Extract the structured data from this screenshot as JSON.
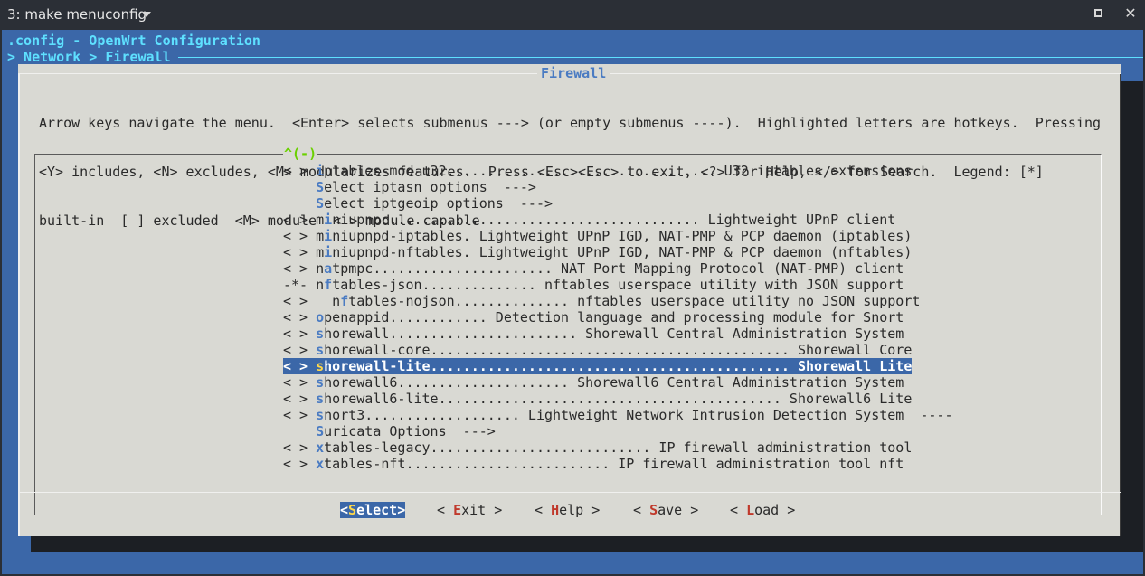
{
  "window": {
    "title": "3: make menuconfig"
  },
  "header": {
    "config_line": ".config - OpenWrt Configuration",
    "breadcrumb": "> Network > Firewall"
  },
  "dialog": {
    "title": "Firewall",
    "help_lines": [
      "Arrow keys navigate the menu.  <Enter> selects submenus ---> (or empty submenus ----).  Highlighted letters are hotkeys.  Pressing",
      "<Y> includes, <N> excludes, <M> modularizes features.  Press <Esc><Esc> to exit, <?> for Help, </> for Search.  Legend: [*]",
      "built-in  [ ] excluded  <M> module  < > module capable"
    ],
    "scroll_indicator": "^(-)"
  },
  "menu": {
    "items": [
      {
        "prefix": "< > ",
        "hotkey": "i",
        "rest": "ptables-mod-u32................................. U32 iptables extensions"
      },
      {
        "prefix": "    ",
        "hotkey": "S",
        "rest": "elect iptasn options  --->"
      },
      {
        "prefix": "    ",
        "hotkey": "S",
        "rest": "elect iptgeoip options  --->"
      },
      {
        "prefix": "< > m",
        "hotkey": "i",
        "rest": "niupnpc...................................... Lightweight UPnP client"
      },
      {
        "prefix": "< > m",
        "hotkey": "i",
        "rest": "niupnpd-iptables. Lightweight UPnP IGD, NAT-PMP & PCP daemon (iptables)"
      },
      {
        "prefix": "< > m",
        "hotkey": "i",
        "rest": "niupnpd-nftables. Lightweight UPnP IGD, NAT-PMP & PCP daemon (nftables)"
      },
      {
        "prefix": "< > n",
        "hotkey": "a",
        "rest": "tpmpc...................... NAT Port Mapping Protocol (NAT-PMP) client"
      },
      {
        "prefix": "-*- n",
        "hotkey": "f",
        "rest": "tables-json.............. nftables userspace utility with JSON support"
      },
      {
        "prefix": "< >   n",
        "hotkey": "f",
        "rest": "tables-nojson.............. nftables userspace utility no JSON support"
      },
      {
        "prefix": "< > ",
        "hotkey": "o",
        "rest": "penappid............ Detection language and processing module for Snort"
      },
      {
        "prefix": "< > ",
        "hotkey": "s",
        "rest": "horewall....................... Shorewall Central Administration System"
      },
      {
        "prefix": "< > ",
        "hotkey": "s",
        "rest": "horewall-core............................................ Shorewall Core"
      },
      {
        "prefix": "< > ",
        "hotkey": "s",
        "rest": "horewall-lite............................................ Shorewall Lite",
        "selected": true
      },
      {
        "prefix": "< > ",
        "hotkey": "s",
        "rest": "horewall6..................... Shorewall6 Central Administration System"
      },
      {
        "prefix": "< > ",
        "hotkey": "s",
        "rest": "horewall6-lite.......................................... Shorewall6 Lite"
      },
      {
        "prefix": "< > ",
        "hotkey": "s",
        "rest": "nort3................... Lightweight Network Intrusion Detection System  ----"
      },
      {
        "prefix": "    ",
        "hotkey": "S",
        "rest": "uricata Options  --->"
      },
      {
        "prefix": "< > ",
        "hotkey": "x",
        "rest": "tables-legacy........................... IP firewall administration tool"
      },
      {
        "prefix": "< > ",
        "hotkey": "x",
        "rest": "tables-nft......................... IP firewall administration tool nft"
      }
    ]
  },
  "buttons": [
    {
      "open": "<",
      "hotkey": "S",
      "rest": "elect",
      "close": ">",
      "active": true
    },
    {
      "open": "< ",
      "hotkey": "E",
      "rest": "xit",
      "close": " >"
    },
    {
      "open": "< ",
      "hotkey": "H",
      "rest": "elp",
      "close": " >"
    },
    {
      "open": "< ",
      "hotkey": "S",
      "rest": "ave",
      "close": " >"
    },
    {
      "open": "< ",
      "hotkey": "L",
      "rest": "oad",
      "close": " >"
    }
  ],
  "colors": {
    "terminal_bg": "#3b67a8",
    "dialog_bg": "#d9d9d3",
    "hotkey": "#4a7bc2",
    "header_text": "#5ee0ff"
  }
}
